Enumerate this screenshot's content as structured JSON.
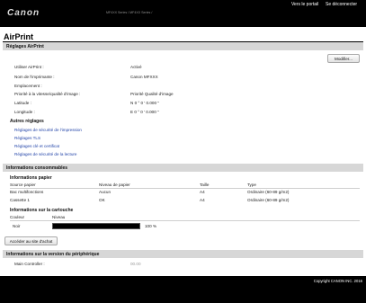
{
  "header": {
    "logo": "Canon",
    "model": "MF4XX Series / MF4XX Series /",
    "portal_link": "Vers le portail",
    "logout_link": "Se déconnecter"
  },
  "page": {
    "title": "AirPrint"
  },
  "airprint_settings": {
    "section_title": "Réglages AirPrint",
    "edit_button": "Modifier...",
    "fields": [
      {
        "label": "Utiliser AirPrint :",
        "value": "Activé"
      },
      {
        "label": "Nom de l'imprimante :",
        "value": "Canon MFXXX"
      },
      {
        "label": "Emplacement :",
        "value": ""
      },
      {
        "label": "Priorité à la vitesse/qualité d'image :",
        "value": "Priorité Qualité d'image"
      },
      {
        "label": "Latitude :",
        "value": "N 0 ° 0 ' 0.000 \""
      },
      {
        "label": "Longitude :",
        "value": "E 0 ° 0 ' 0.000 \""
      }
    ]
  },
  "other_settings": {
    "title": "Autres réglages",
    "links": [
      "Réglages de sécurité de l'impression",
      "Réglages TLS",
      "Réglages clé et certificat",
      "Réglages de sécurité de la lecture"
    ]
  },
  "consumables": {
    "section_title": "Informations consommables",
    "paper": {
      "title": "Informations papier",
      "columns": [
        "Source papier",
        "Niveau de papier",
        "Taille",
        "Type"
      ],
      "rows": [
        [
          "Bac multifonctions",
          "Aucun",
          "A4",
          "Ordinaire (60-89 g/m2)"
        ],
        [
          "Cassette 1",
          "OK",
          "A4",
          "Ordinaire (60-89 g/m2)"
        ]
      ]
    },
    "cartridge": {
      "title": "Informations sur la cartouche",
      "columns": [
        "Couleur",
        "Niveau"
      ],
      "rows": [
        {
          "color": "Noir",
          "level_percent": 100,
          "level_text": "100 %"
        }
      ]
    },
    "purchase_button": "Accéder au site d'achat"
  },
  "device_version": {
    "section_title": "Informations sur la version du périphérique",
    "rows": [
      {
        "label": "Main Controller :",
        "value": "00.00"
      }
    ]
  },
  "footer": {
    "copyright": "Copyright CANON INC. 2016"
  }
}
